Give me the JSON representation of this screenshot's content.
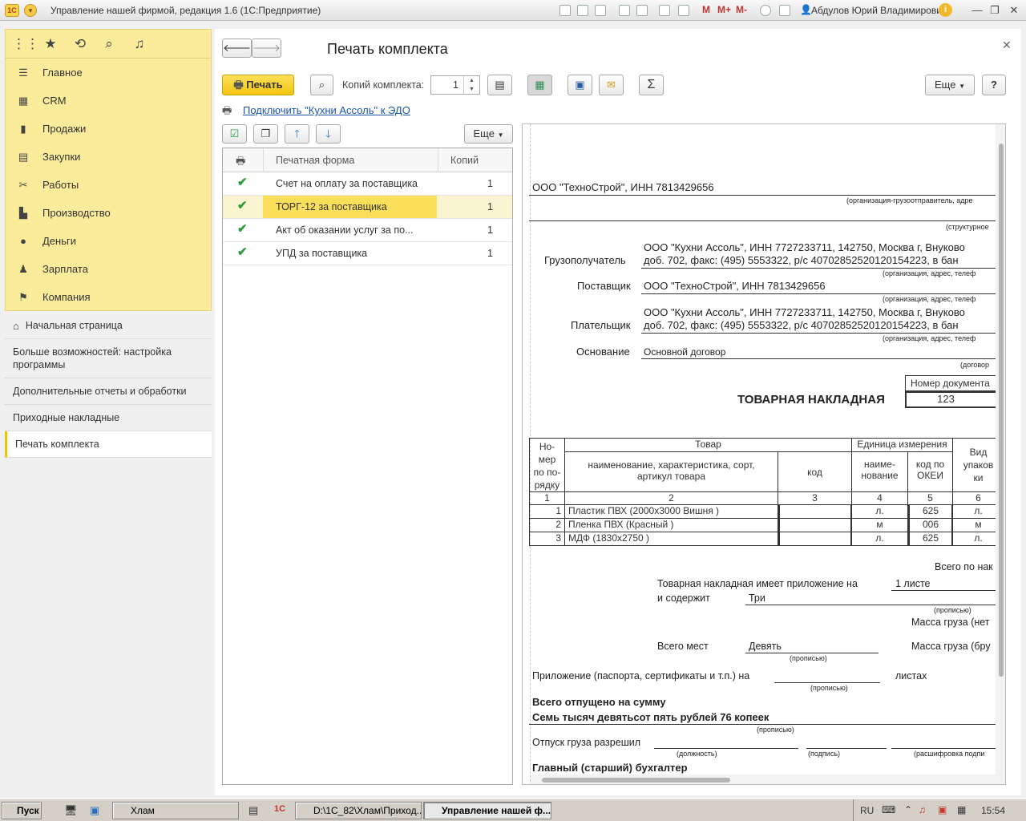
{
  "window": {
    "title": "Управление нашей фирмой, редакция 1.6  (1С:Предприятие)",
    "logo": "1С",
    "toolbar_m": [
      "M",
      "M+",
      "M-"
    ],
    "user": "Абдулов Юрий Владимирович"
  },
  "sections": [
    {
      "label": "Главное",
      "icon": "☰"
    },
    {
      "label": "CRM",
      "icon": "▦"
    },
    {
      "label": "Продажи",
      "icon": "▮"
    },
    {
      "label": "Закупки",
      "icon": "▤"
    },
    {
      "label": "Работы",
      "icon": "✂"
    },
    {
      "label": "Производство",
      "icon": "▙"
    },
    {
      "label": "Деньги",
      "icon": "●"
    },
    {
      "label": "Зарплата",
      "icon": "♟"
    },
    {
      "label": "Компания",
      "icon": "⚑"
    }
  ],
  "nav": [
    {
      "label": "Начальная страница"
    },
    {
      "label": "Больше возможностей: настройка программы"
    },
    {
      "label": "Дополнительные отчеты и обработки"
    },
    {
      "label": "Приходные накладные"
    },
    {
      "label": "Печать комплекта"
    }
  ],
  "form": {
    "title": "Печать комплекта",
    "print_label": "Печать",
    "copies_label": "Копий комплекта:",
    "copies_value": "1",
    "more_label": "Еще",
    "help_label": "?",
    "sum_label": "Σ",
    "edo_link": "Подключить \"Кухни Ассоль\" к ЭДО"
  },
  "table": {
    "more_label": "Еще",
    "col_form": "Печатная форма",
    "col_copies": "Копий",
    "rows": [
      {
        "name": "Счет на оплату за поставщика",
        "copies": "1"
      },
      {
        "name": "ТОРГ-12 за поставщика",
        "copies": "1"
      },
      {
        "name": "Акт об оказании услуг за по...",
        "copies": "1"
      },
      {
        "name": "УПД  за поставщика",
        "copies": "1"
      }
    ]
  },
  "doc": {
    "shipper": "ООО \"ТехноСтрой\",  ИНН 7813429656",
    "shipper_cap": "(организация-грузоотправитель, адре",
    "struct_cap": "(структурное",
    "consignee_label": "Грузополучатель",
    "consignee_l1": "ООО \"Кухни Ассоль\",  ИНН 7727233711,  142750, Москва г, Внуково",
    "consignee_l2": "доб. 702,  факс: (495) 5553322,  р/с 40702852520120154223,  в бан",
    "addr_cap": "(организация, адрес, телеф",
    "supplier_label": "Поставщик",
    "supplier": "ООО \"ТехноСтрой\",  ИНН 7813429656",
    "payer_label": "Плательщик",
    "payer_l1": "ООО \"Кухни Ассоль\",  ИНН 7727233711,   142750, Москва г, Внуково",
    "payer_l2": "доб. 702,  факс: (495) 5553322,  р/с 40702852520120154223,  в бан",
    "basis_label": "Основание",
    "basis": "Основной договор",
    "basis_cap": "(договор",
    "docnum_label": "Номер документа",
    "docnum": "123",
    "doc_title": "ТОВАРНАЯ НАКЛАДНАЯ",
    "th_num": "Но-\nмер\nпо по-\nрядку",
    "th_goods": "Товар",
    "th_name": "наименование, характеристика, сорт, артикул товара",
    "th_code": "код",
    "th_unit": "Единица измерения",
    "th_unit_name": "наиме-\nнование",
    "th_okei": "код по\nОКЕИ",
    "th_pack": "Вид\nупаков\nки",
    "col_nums": [
      "1",
      "2",
      "3",
      "4",
      "5",
      "6"
    ],
    "items": [
      {
        "n": "1",
        "name": "Пластик ПВХ (2000х3000 Вишня )",
        "unit": "л.",
        "okei": "625",
        "pack": "л."
      },
      {
        "n": "2",
        "name": "Пленка ПВХ (Красный )",
        "unit": "м",
        "okei": "006",
        "pack": "м"
      },
      {
        "n": "3",
        "name": "МДФ (1830х2750 )",
        "unit": "л.",
        "okei": "625",
        "pack": "л."
      }
    ],
    "total_label": "Всего по нак",
    "appendix_text": "Товарная накладная имеет приложение на",
    "appendix_val": "1 листе",
    "contains_label": "и содержит",
    "contains_val": "Три",
    "propisyu": "(прописью)",
    "mass_net": "Масса груза (нет",
    "places_label": "Всего мест",
    "places_val": "Девять",
    "mass_gross": "Масса груза (бру",
    "attachment": "Приложение (паспорта, сертификаты и т.п.) на",
    "sheets": "листах",
    "released_sum": "Всего отпущено  на сумму",
    "sum_words": "Семь тысяч девятьсот пять рублей 76 копеек",
    "permit": "Отпуск груза разрешил",
    "cap_position": "(должность)",
    "cap_sign": "(подпись)",
    "cap_decode": "(расшифровка подпи",
    "chief_acc": "Главный (старший) бухгалтер"
  },
  "taskbar": {
    "start": "Пуск",
    "items": [
      "Хлам",
      "D:\\1C_82\\Хлам\\Приход...",
      "Управление нашей ф..."
    ],
    "lang": "RU",
    "time": "15:54"
  }
}
